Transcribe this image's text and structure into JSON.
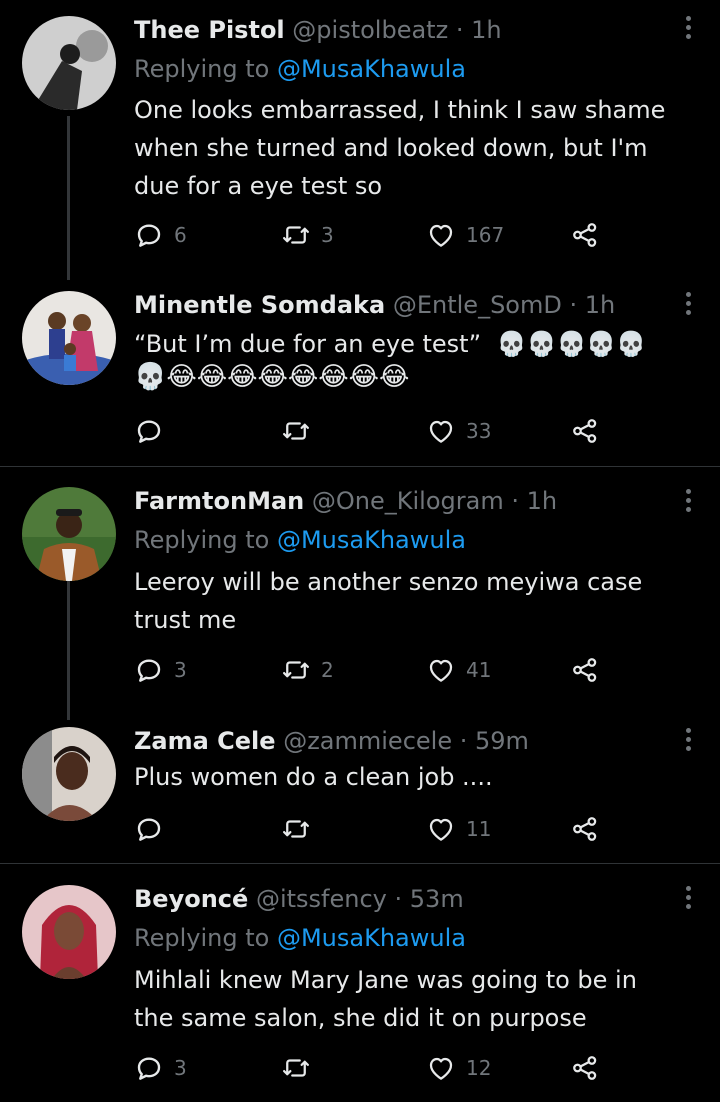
{
  "replying_label": "Replying to",
  "tweets": [
    {
      "name": "Thee Pistol",
      "handle": "@pistolbeatz",
      "time": "1h",
      "reply_to": "@MusaKhawula",
      "text": "One looks embarrassed, I think I saw shame when she turned and looked down, but I'm due for a eye test so",
      "replies": "6",
      "retweets": "3",
      "likes": "167"
    },
    {
      "name": "Minentle Somdaka",
      "handle": "@Entle_SomD",
      "time": "1h",
      "text": "“But I’m due for an eye test”",
      "emoji_line1": "💀💀💀💀💀",
      "emoji_line2": "💀😂😂😂😂😂😂😂😂",
      "replies": "",
      "retweets": "",
      "likes": "33"
    },
    {
      "name": "FarmtonMan",
      "handle": "@One_Kilogram",
      "time": "1h",
      "reply_to": "@MusaKhawula",
      "text": "Leeroy will be another senzo meyiwa case trust me",
      "replies": "3",
      "retweets": "2",
      "likes": "41"
    },
    {
      "name": "Zama Cele",
      "handle": "@zammiecele",
      "time": "59m",
      "text": "Plus women do a clean job ....",
      "replies": "",
      "retweets": "",
      "likes": "11"
    },
    {
      "name": "Beyoncé",
      "handle": "@itssfency",
      "time": "53m",
      "reply_to": "@MusaKhawula",
      "text": "Mihlali knew Mary Jane was going to be in the same salon, she did it on purpose",
      "replies": "3",
      "retweets": "",
      "likes": "12"
    }
  ],
  "colors": {
    "background": "#000000",
    "text": "#e7e9ea",
    "secondary": "#71767b",
    "link": "#1d9bf0",
    "divider": "#2f3336"
  },
  "icons": [
    "more-icon",
    "reply-icon",
    "retweet-icon",
    "like-icon",
    "share-icon"
  ]
}
